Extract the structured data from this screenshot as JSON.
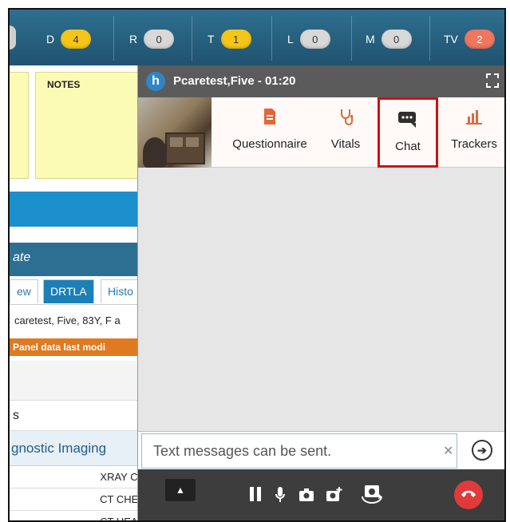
{
  "counters": [
    {
      "label": "D",
      "value": "4",
      "tone": "yellow"
    },
    {
      "label": "R",
      "value": "0",
      "tone": "gray"
    },
    {
      "label": "T",
      "value": "1",
      "tone": "yellow"
    },
    {
      "label": "L",
      "value": "0",
      "tone": "gray"
    },
    {
      "label": "M",
      "value": "0",
      "tone": "gray"
    },
    {
      "label": "TV",
      "value": "2",
      "tone": "red"
    }
  ],
  "notes": {
    "title": "NOTES"
  },
  "section": {
    "title": "ate"
  },
  "tabs": [
    {
      "label": "ew"
    },
    {
      "label": "DRTLA"
    },
    {
      "label": "Histo"
    }
  ],
  "patient_line": "caretest, Five, 83Y, F a",
  "alert_line": "Panel data last modi",
  "rows": {
    "s_label": "s",
    "imaging_label": "gnostic Imaging",
    "items": [
      "XRAY CH",
      "CT CHES",
      "CT HEAD"
    ]
  },
  "panel": {
    "logo": "h",
    "session_title": "Pcaretest,Five - 01:20",
    "nav": [
      {
        "label": "Questionnaire"
      },
      {
        "label": "Vitals"
      },
      {
        "label": "Chat"
      },
      {
        "label": "Trackers"
      }
    ],
    "input_placeholder": "Text messages can be sent."
  },
  "colors": {
    "accent_blue": "#1c8fcd",
    "header_gray": "#5b5b5b",
    "highlight_red": "#d01010",
    "end_call_red": "#e03a3a"
  }
}
